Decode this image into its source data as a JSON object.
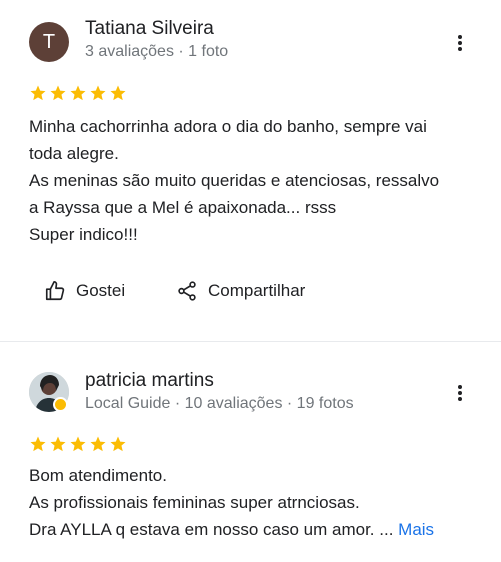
{
  "reviews": [
    {
      "avatar_letter": "T",
      "avatar_color": "#5d4037",
      "name": "Tatiana Silveira",
      "meta": "3 avaliações · 1 foto",
      "rating": 5,
      "text_lines": [
        "Minha cachorrinha adora o dia do banho, sempre vai",
        "toda alegre.",
        "As meninas são muito queridas e atenciosas, ressalvo",
        "a Rayssa que a Mel é apaixonada... rsss",
        "Super indico!!!"
      ],
      "actions": {
        "like_label": "Gostei",
        "share_label": "Compartilhar"
      }
    },
    {
      "name": "patricia martins",
      "meta": "Local Guide · 10 avaliações · 19 fotos",
      "rating": 5,
      "text_lines": [
        "Bom atendimento.",
        "As profissionais femininas super atrnciosas.",
        "Dra AYLLA q estava em nosso caso um amor. ..."
      ],
      "more_link": "Mais"
    }
  ],
  "colors": {
    "star": "#fbbc04",
    "link": "#1a73e8",
    "secondary_text": "#70757a"
  },
  "icons": [
    "more-vert-icon",
    "star-icon",
    "thumb-up-icon",
    "share-icon",
    "local-guide-badge-icon"
  ]
}
